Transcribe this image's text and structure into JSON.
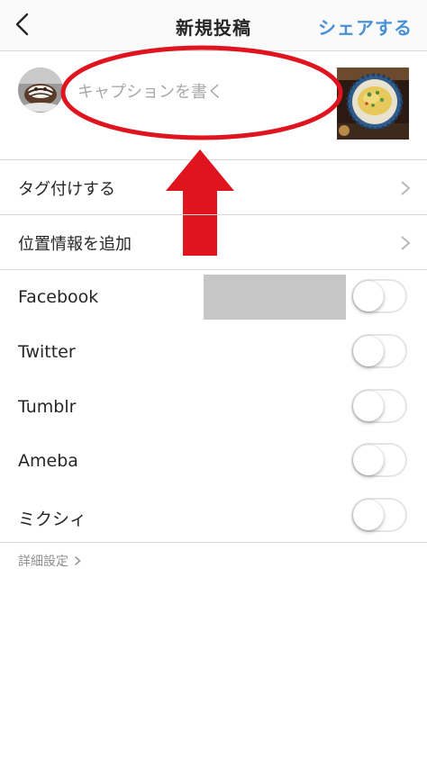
{
  "header": {
    "title": "新規投稿",
    "share_label": "シェアする"
  },
  "caption": {
    "placeholder": "キャプションを書く",
    "value": ""
  },
  "menu": {
    "items": [
      {
        "label": "タグ付けする"
      },
      {
        "label": "位置情報を追加"
      }
    ]
  },
  "share_targets": [
    {
      "label": "Facebook",
      "enabled": false
    },
    {
      "label": "Twitter",
      "enabled": false
    },
    {
      "label": "Tumblr",
      "enabled": false
    },
    {
      "label": "Ameba",
      "enabled": false
    },
    {
      "label": "ミクシィ",
      "enabled": false
    }
  ],
  "advanced_settings_label": "詳細設定",
  "colors": {
    "accent": "#4a90d9",
    "annotation_red": "#e0141e",
    "divider": "#dbdbdb",
    "placeholder": "#a8a8a8"
  }
}
